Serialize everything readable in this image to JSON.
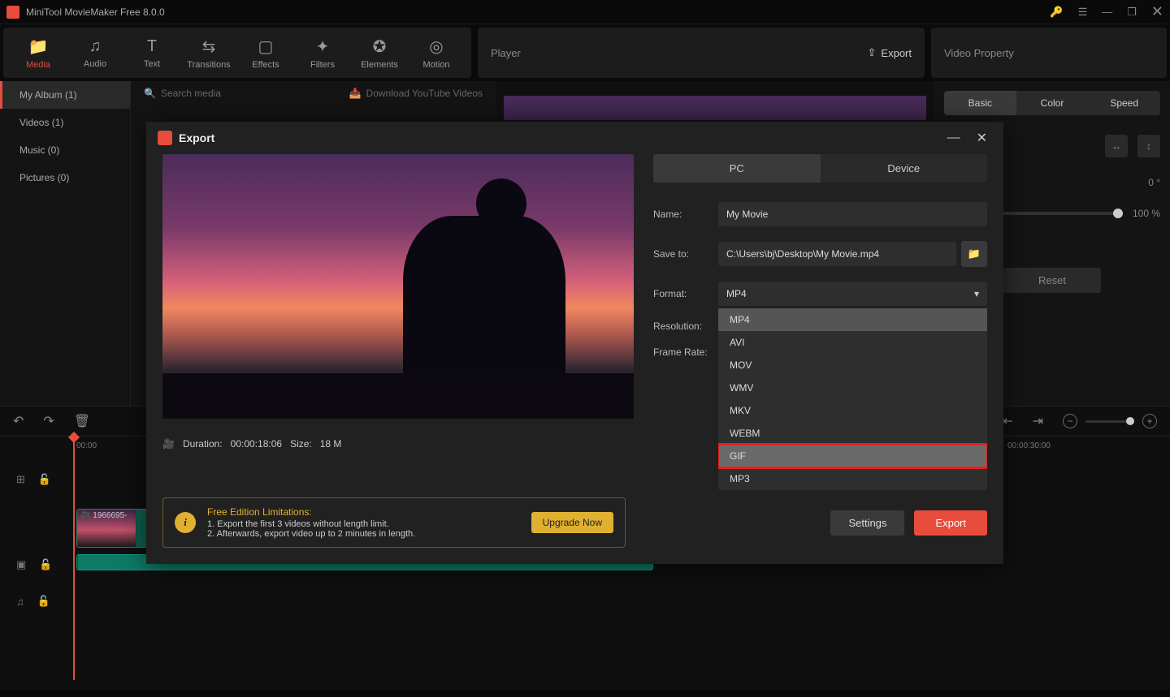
{
  "app": {
    "title": "MiniTool MovieMaker Free 8.0.0"
  },
  "toolbar": {
    "tabs": [
      {
        "label": "Media"
      },
      {
        "label": "Audio"
      },
      {
        "label": "Text"
      },
      {
        "label": "Transitions"
      },
      {
        "label": "Effects"
      },
      {
        "label": "Filters"
      },
      {
        "label": "Elements"
      },
      {
        "label": "Motion"
      }
    ],
    "player_label": "Player",
    "export_label": "Export",
    "prop_label": "Video Property"
  },
  "sidebar": {
    "items": [
      {
        "label": "My Album (1)"
      },
      {
        "label": "Videos (1)"
      },
      {
        "label": "Music (0)"
      },
      {
        "label": "Pictures (0)"
      }
    ]
  },
  "media": {
    "search_placeholder": "Search media",
    "download_label": "Download YouTube Videos"
  },
  "props": {
    "tabs": {
      "basic": "Basic",
      "color": "Color",
      "speed": "Speed"
    },
    "rotate": "0 °",
    "scale": "100 %",
    "reset": "Reset"
  },
  "timeline": {
    "ticks": {
      "t0": "00:00",
      "t30": "00:00:30:00"
    },
    "clip_label": "1966695-"
  },
  "modal": {
    "title": "Export",
    "tabs": {
      "pc": "PC",
      "device": "Device"
    },
    "labels": {
      "name": "Name:",
      "save": "Save to:",
      "format": "Format:",
      "resolution": "Resolution:",
      "framerate": "Frame Rate:"
    },
    "values": {
      "name": "My Movie",
      "save": "C:\\Users\\bj\\Desktop\\My Movie.mp4",
      "format": "MP4"
    },
    "format_options": [
      "MP4",
      "AVI",
      "MOV",
      "WMV",
      "MKV",
      "WEBM",
      "GIF",
      "MP3"
    ],
    "meta": {
      "duration_label": "Duration:",
      "duration": "00:00:18:06",
      "size_label": "Size:",
      "size": "18 M"
    },
    "limitations": {
      "title": "Free Edition Limitations:",
      "line1": "1. Export the first 3 videos without length limit.",
      "line2": "2. Afterwards, export video up to 2 minutes in length.",
      "upgrade": "Upgrade Now"
    },
    "actions": {
      "settings": "Settings",
      "export": "Export"
    }
  }
}
